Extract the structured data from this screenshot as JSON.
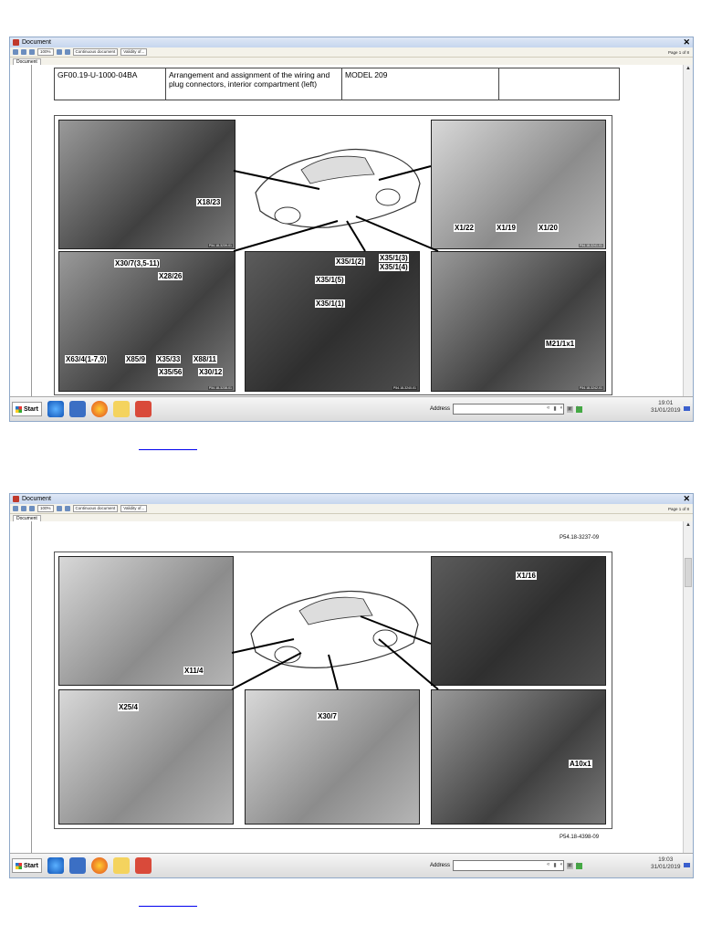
{
  "screenshots": [
    {
      "window_title": "Document",
      "zoom": "100%",
      "view_mode": "Continuous document",
      "validity": "Validity of...",
      "page_info": "Page 1 of 8",
      "tab": "Document",
      "header_table": [
        "GF00.19-U-1000-04BA",
        "Arrangement and assignment of the wiring and plug connectors, interior compartment (left)",
        "MODEL 209",
        ""
      ],
      "photo_codes": [
        "P54.18-3239-01",
        "P54.18-3241-01",
        "P54.18-3238-01",
        "P54.18-3240-01",
        "P54.18-3242-01"
      ],
      "labels": [
        "X18/23",
        "X1/22",
        "X1/19",
        "X1/20",
        "X30/7(3,5-11)",
        "X28/26",
        "X63/4(1-7,9)",
        "X85/9",
        "X35/33",
        "X88/11",
        "X35/56",
        "X30/12",
        "X35/1(2)",
        "X35/1(3)",
        "X35/1(4)",
        "X35/1(5)",
        "X35/1(1)",
        "M21/1x1"
      ],
      "taskbar": {
        "start": "Start",
        "address_label": "Address",
        "time": "19:01",
        "date": "31/01/2019"
      }
    },
    {
      "window_title": "Document",
      "zoom": "100%",
      "view_mode": "Continuous document",
      "validity": "Validity of...",
      "page_info": "Page 1 of 8",
      "tab": "Document",
      "top_ref": "P54.18-3237-09",
      "bottom_ref": "P54.18-4398-09",
      "labels": [
        "X11/4",
        "X1/16",
        "X25/4",
        "X30/7",
        "A10x1"
      ],
      "taskbar": {
        "start": "Start",
        "address_label": "Address",
        "time": "19:03",
        "date": "31/01/2019"
      }
    }
  ]
}
